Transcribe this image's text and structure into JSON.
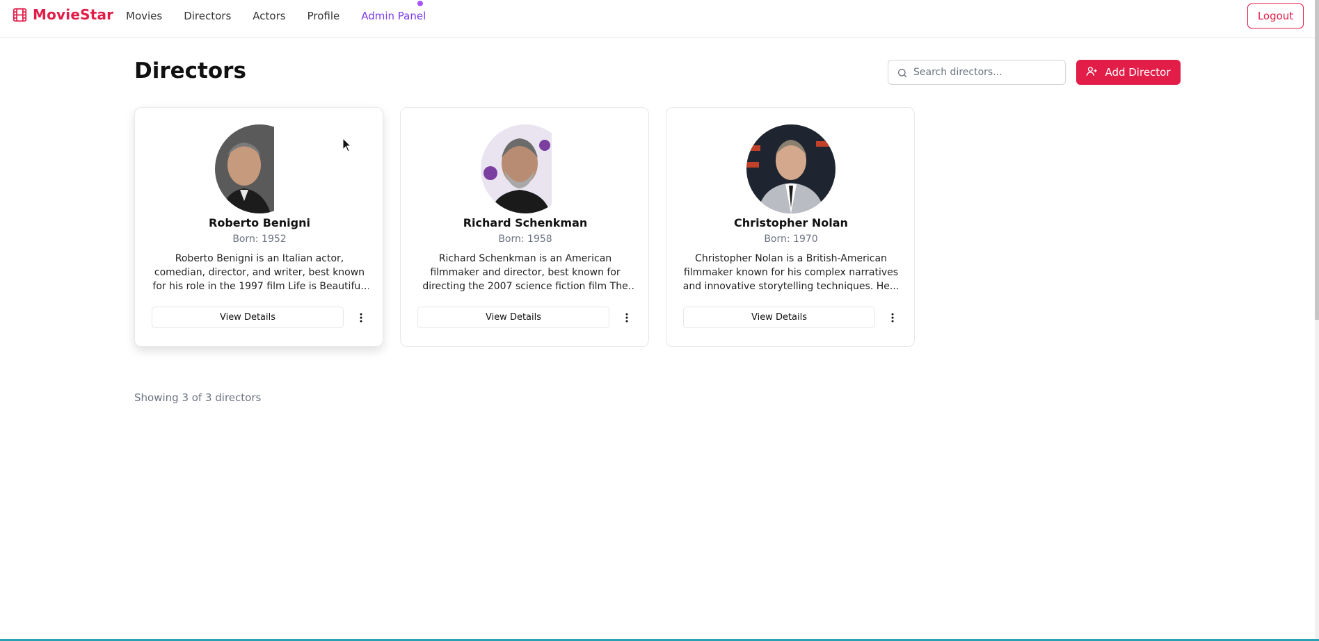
{
  "nav": {
    "brand": "MovieStar",
    "links": [
      "Movies",
      "Directors",
      "Actors",
      "Profile",
      "Admin Panel"
    ],
    "logout": "Logout"
  },
  "header": {
    "title": "Directors",
    "search_placeholder": "Search directors...",
    "add_button": "Add Director"
  },
  "directors": [
    {
      "name": "Roberto Benigni",
      "born": "Born: 1952",
      "description": "Roberto Benigni is an Italian actor, comedian, director, and writer, best known for his role in the 1997 film Life is Beautiful, which he also...",
      "view_label": "View Details"
    },
    {
      "name": "Richard Schenkman",
      "born": "Born: 1958",
      "description": "Richard Schenkman is an American filmmaker and director, best known for directing the 2007 science fiction film The Man from Earth. He...",
      "view_label": "View Details"
    },
    {
      "name": "Christopher Nolan",
      "born": "Born: 1970",
      "description": "Christopher Nolan is a British-American filmmaker known for his complex narratives and innovative storytelling techniques. He...",
      "view_label": "View Details"
    }
  ],
  "footer": {
    "showing": "Showing 3 of 3 directors"
  },
  "colors": {
    "brand": "#e11d48",
    "admin": "#7c3aed"
  },
  "icons": {
    "logo": "film-icon",
    "search": "search-icon",
    "add": "user-plus-icon",
    "more": "more-vertical-icon"
  }
}
